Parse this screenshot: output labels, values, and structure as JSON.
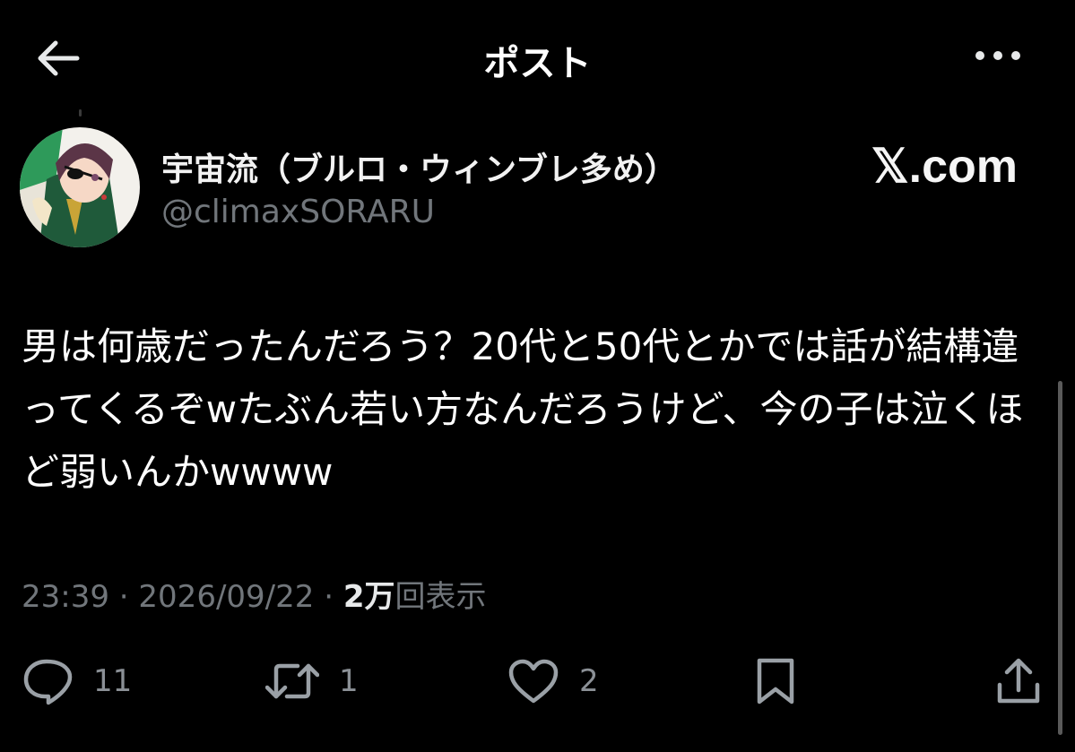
{
  "header": {
    "title": "ポスト",
    "back_icon": "arrow-left-icon",
    "more_icon": "more-horizontal-icon"
  },
  "author": {
    "display_name": "宇宙流（ブルロ・ウィンブレ多め）",
    "handle": "@climaxSORARU",
    "avatar_icon": "avatar-illustration"
  },
  "watermark": "𝕏.com",
  "tweet": {
    "text": "男は何歳だったんだろう？20代と50代とかでは話が結構違ってくるぞwたぶん若い方なんだろうけど、今の子は泣くほど弱いんかwwww"
  },
  "meta": {
    "time": "23:39",
    "separator": " · ",
    "date": "2026/09/22",
    "views_count": "2万",
    "views_label": "回表示"
  },
  "actions": {
    "reply": {
      "icon": "reply-icon",
      "count": "11"
    },
    "repost": {
      "icon": "repost-icon",
      "count": "1"
    },
    "like": {
      "icon": "heart-icon",
      "count": "2"
    },
    "bookmark": {
      "icon": "bookmark-icon"
    },
    "share": {
      "icon": "share-icon"
    }
  },
  "colors": {
    "background": "#000000",
    "text_primary": "#ffffff",
    "text_secondary": "#71767b"
  }
}
